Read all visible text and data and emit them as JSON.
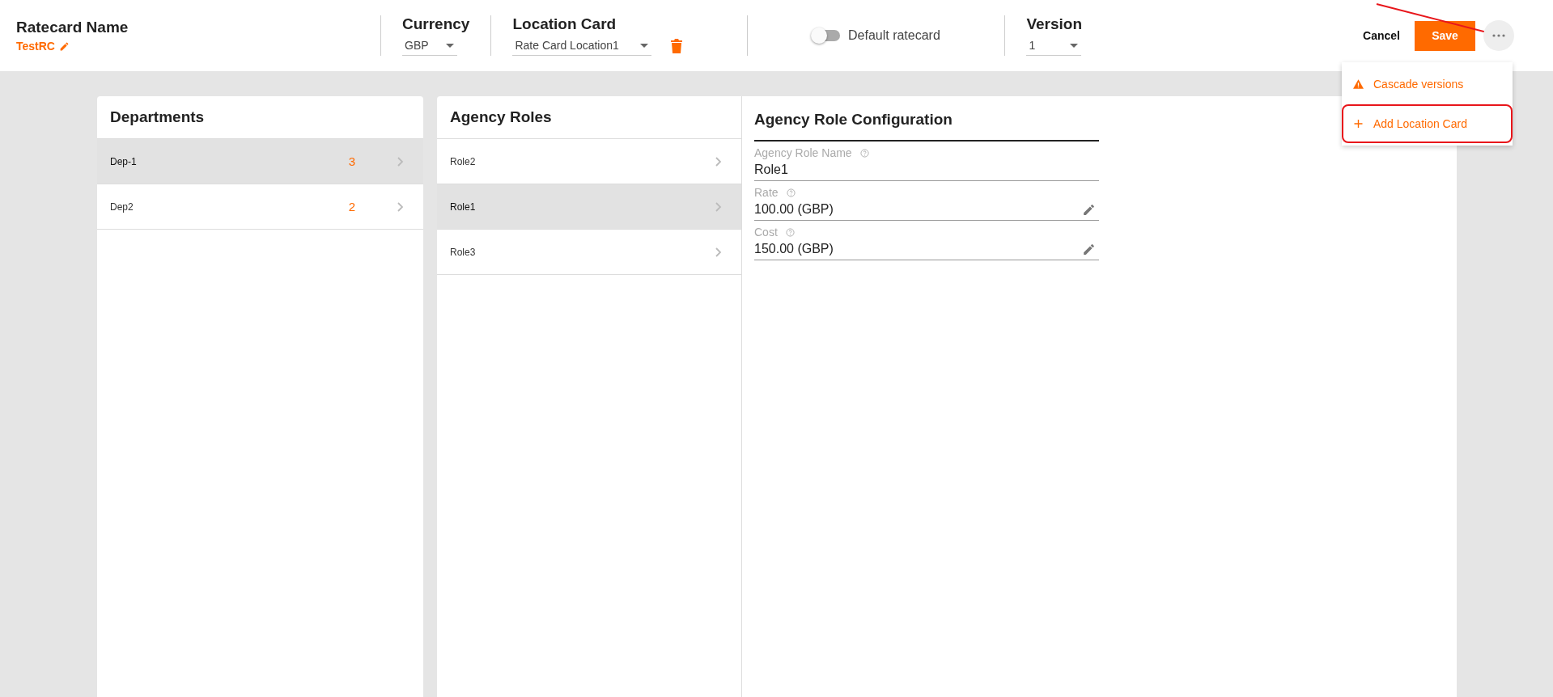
{
  "header": {
    "ratecard_name": {
      "label": "Ratecard Name",
      "value": "TestRC"
    },
    "currency": {
      "label": "Currency",
      "value": "GBP"
    },
    "location_card": {
      "label": "Location Card",
      "value": "Rate Card Location1"
    },
    "default_ratecard": {
      "label": "Default ratecard",
      "on": false
    },
    "version": {
      "label": "Version",
      "value": "1"
    },
    "buttons": {
      "cancel": "Cancel",
      "save": "Save"
    }
  },
  "menu": {
    "items": [
      {
        "kind": "warning",
        "label": "Cascade versions",
        "highlighted": false
      },
      {
        "kind": "add",
        "label": "Add Location Card",
        "highlighted": true
      }
    ]
  },
  "departments": {
    "title": "Departments",
    "items": [
      {
        "name": "Dep-1",
        "count": "3",
        "selected": true
      },
      {
        "name": "Dep2",
        "count": "2",
        "selected": false
      }
    ]
  },
  "agency_roles": {
    "title": "Agency Roles",
    "items": [
      {
        "name": "Role2",
        "selected": false
      },
      {
        "name": "Role1",
        "selected": true
      },
      {
        "name": "Role3",
        "selected": false
      }
    ]
  },
  "configuration": {
    "title": "Agency Role Configuration",
    "fields": [
      {
        "label": "Agency Role Name",
        "value": "Role1",
        "editable": false
      },
      {
        "label": "Rate",
        "value": "100.00 (GBP)",
        "editable": true
      },
      {
        "label": "Cost",
        "value": "150.00 (GBP)",
        "editable": true
      }
    ]
  }
}
